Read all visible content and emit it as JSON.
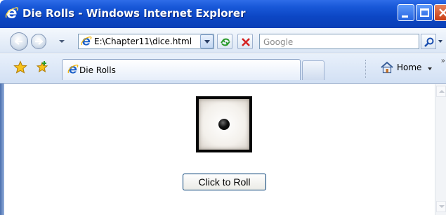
{
  "window": {
    "title": "Die Rolls - Windows Internet Explorer"
  },
  "addressbar": {
    "url": "E:\\Chapter11\\dice.html",
    "search_placeholder": "Google"
  },
  "tabs": [
    {
      "label": "Die Rolls",
      "active": true
    }
  ],
  "commandbar": {
    "home_label": "Home"
  },
  "page": {
    "die_value": 1,
    "roll_button_label": "Click to Roll"
  },
  "colors": {
    "titlebar": "#0c46c4",
    "button_border": "#003c74"
  }
}
